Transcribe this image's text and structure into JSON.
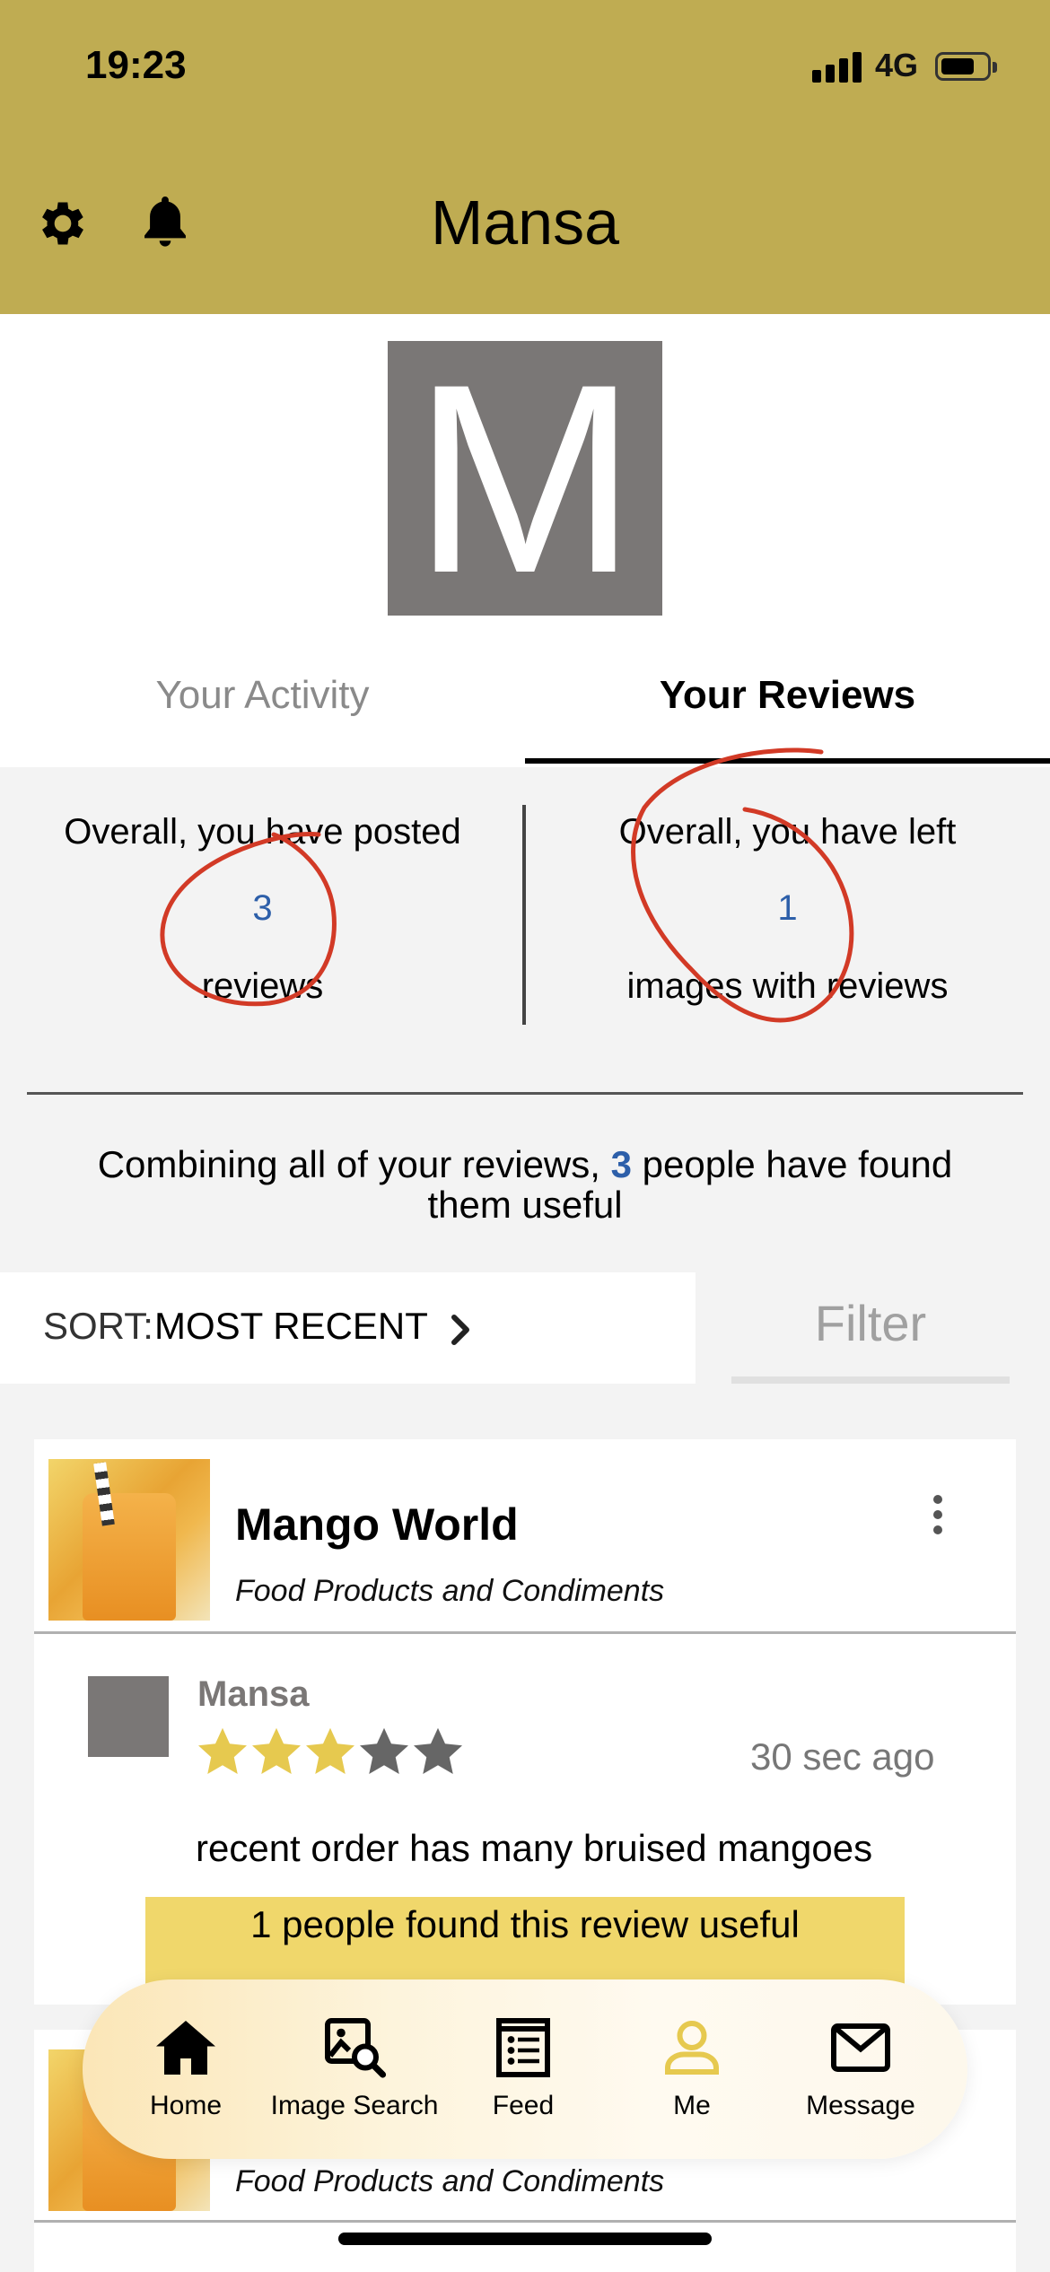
{
  "status_bar": {
    "time": "19:23",
    "network": "4G"
  },
  "header": {
    "title": "Mansa"
  },
  "profile": {
    "avatar_letter": "M"
  },
  "tabs": [
    {
      "label": "Your Activity",
      "active": false
    },
    {
      "label": "Your Reviews",
      "active": true
    }
  ],
  "stats": {
    "left": {
      "line1": "Overall, you have posted",
      "value": "3",
      "line3": "reviews"
    },
    "right": {
      "line1": "Overall, you have left",
      "value": "1",
      "line3": "images with reviews"
    }
  },
  "summary": {
    "prefix": "Combining all of your reviews, ",
    "count": "3",
    "suffix": " people have found them useful"
  },
  "sort": {
    "label": "SORT:",
    "value": "MOST RECENT"
  },
  "filter": {
    "label": "Filter"
  },
  "reviews": [
    {
      "place_name": "Mango World",
      "category": "Food Products and Condiments",
      "reviewer": "Mansa",
      "rating": 3,
      "rating_max": 5,
      "time": "30 sec ago",
      "text": "recent order has many bruised mangoes",
      "useful_text": "1 people found this review useful"
    },
    {
      "place_name": "",
      "category": "Food Products and Condiments"
    }
  ],
  "tabbar": [
    {
      "label": "Home",
      "icon": "home-icon"
    },
    {
      "label": "Image Search",
      "icon": "image-search-icon"
    },
    {
      "label": "Feed",
      "icon": "feed-icon"
    },
    {
      "label": "Me",
      "icon": "person-icon",
      "active": true
    },
    {
      "label": "Message",
      "icon": "envelope-icon"
    }
  ],
  "colors": {
    "header": "#bfac52",
    "accent_blue": "#2d5fa9",
    "star_filled": "#e6c94f",
    "star_empty": "#666666",
    "useful_bar": "#f0d76b",
    "active_tab_icon": "#e6c94f"
  }
}
